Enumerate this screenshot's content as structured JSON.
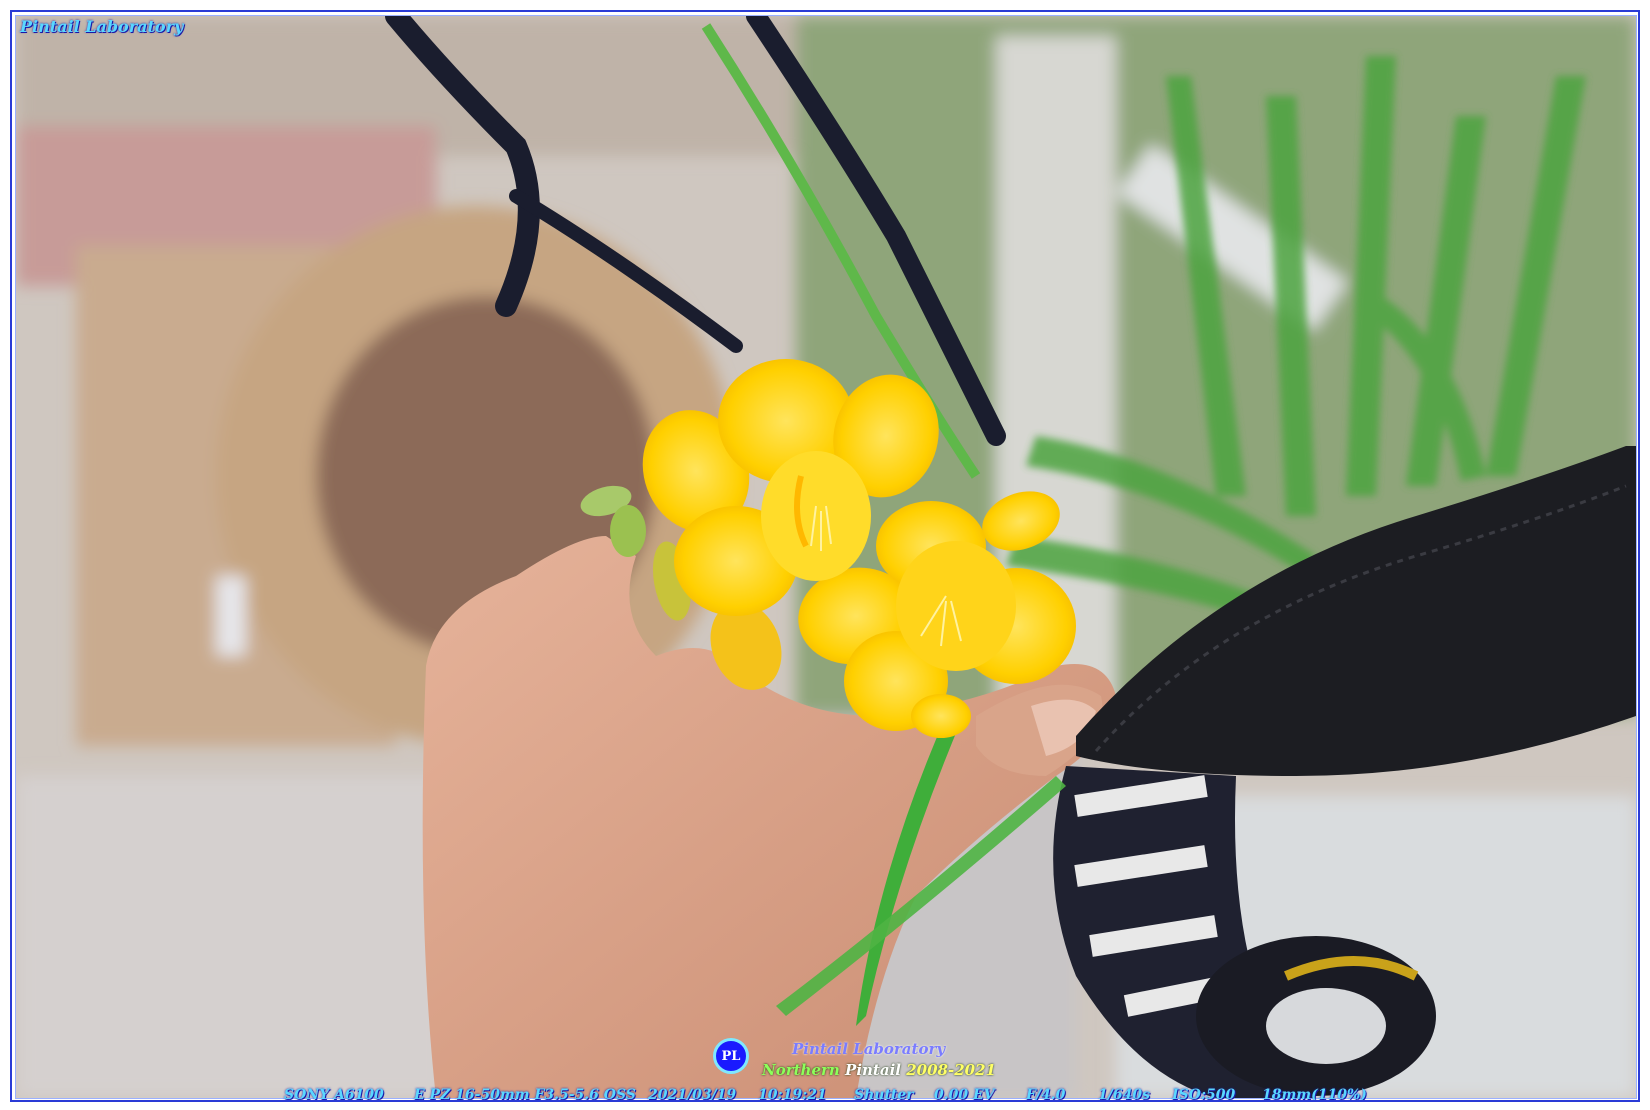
{
  "watermark": {
    "top_left": "Pintail Laboratory",
    "logo_text": "PL",
    "brand_line1": "Pintail Laboratory",
    "brand_line2_part1": "Northern",
    "brand_line2_part2": "Pintail",
    "brand_line2_part3": "2008-2021"
  },
  "exif": {
    "camera": "SONY A6100",
    "lens": "E PZ 16-50mm F3.5-5.6 OSS",
    "date": "2021/03/19",
    "time": "10:19:21",
    "mode": "Shutter",
    "ev": "0.00 EV",
    "aperture": "F/4.0",
    "shutter": "1/640s",
    "iso": "ISO:500",
    "focal": "18mm(110%)"
  },
  "colors": {
    "frame_border": "#2a3bd6",
    "watermark_text": "#5ad7ff",
    "flower_yellow": "#ffd400",
    "leaf_green": "#3fae3a"
  }
}
